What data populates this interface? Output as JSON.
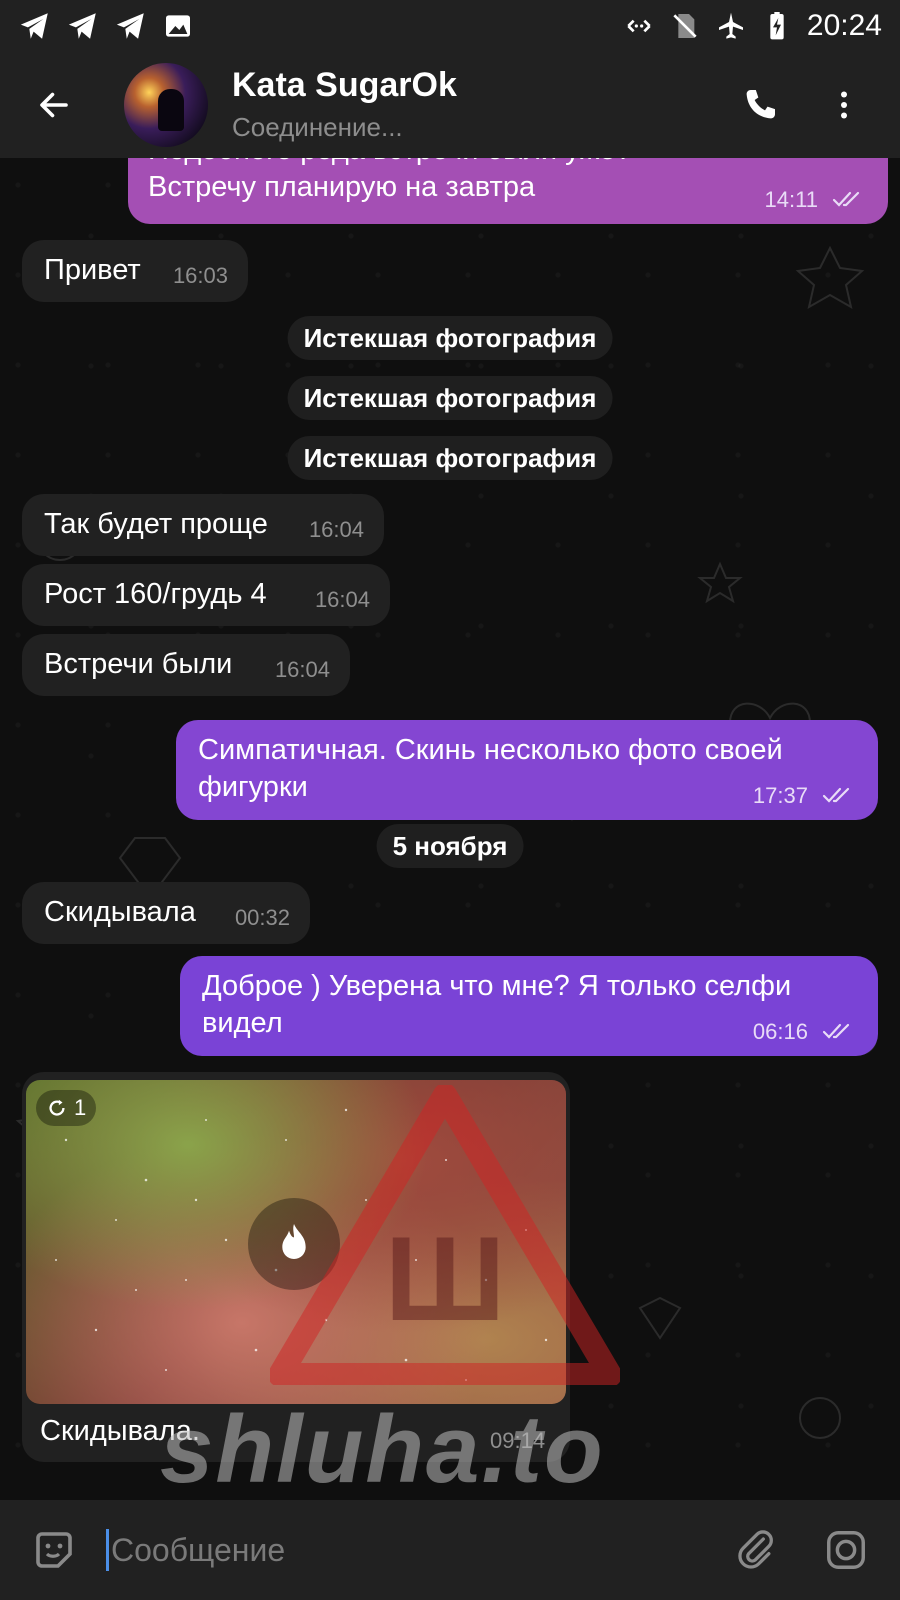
{
  "status_bar": {
    "time": "20:24"
  },
  "header": {
    "contact_name": "Kata SugarOk",
    "status": "Соединение..."
  },
  "messages": [
    {
      "dir": "out",
      "text_line1": "Подобного рода встречи были уже?",
      "text_line2": "Встречу планирую на завтра",
      "time": "14:11"
    },
    {
      "dir": "in",
      "text": "Привет",
      "time": "16:03"
    },
    {
      "dir": "in",
      "text": "Так будет проще",
      "time": "16:04"
    },
    {
      "dir": "in",
      "text": "Рост 160/грудь 4",
      "time": "16:04"
    },
    {
      "dir": "in",
      "text": "Встречи были",
      "time": "16:04"
    },
    {
      "dir": "out",
      "text_line1": "Симпатичная. Скинь несколько фото своей",
      "text_line2": "фигурки",
      "time": "17:37"
    },
    {
      "dir": "in",
      "text": "Скидывала",
      "time": "00:32"
    },
    {
      "dir": "out",
      "text_line1": "Доброе ) Уверена что мне? Я только селфи",
      "text_line2": "видел",
      "time": "06:16"
    },
    {
      "dir": "in",
      "text": "Скидывала.",
      "time": "09:14",
      "photo_counter": "1"
    }
  ],
  "service": {
    "expired_photo": "Истекшая фотография",
    "date_divider": "5 ноября"
  },
  "input": {
    "placeholder": "Сообщение"
  },
  "watermark": {
    "text": "shluha.to",
    "symbol": "Ш"
  },
  "colors": {
    "outgoing_top": "#a44fb4",
    "outgoing_mid": "#8446d2",
    "outgoing_bottom": "#7a43d6",
    "incoming": "#212121",
    "background": "#0f0f0f"
  }
}
